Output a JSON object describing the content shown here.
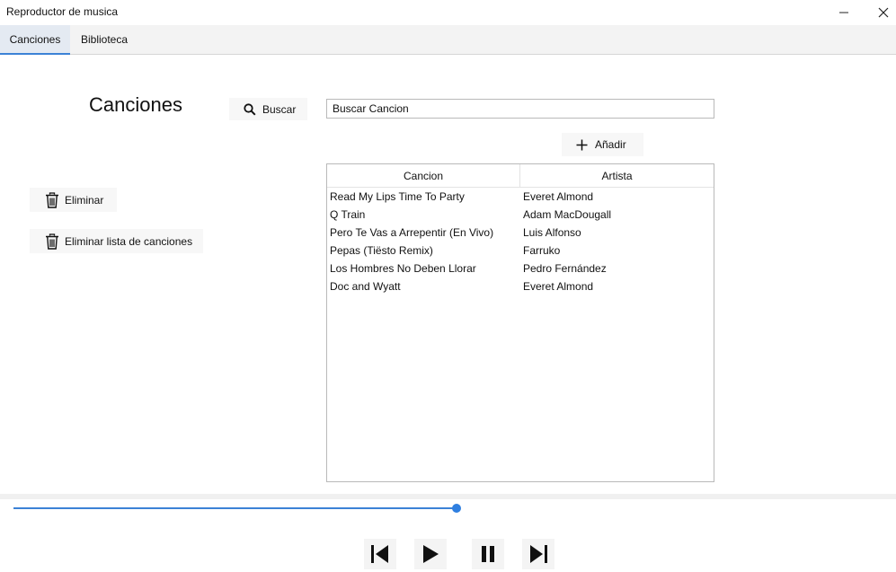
{
  "window": {
    "title": "Reproductor de musica"
  },
  "tabs": [
    {
      "label": "Canciones",
      "active": true
    },
    {
      "label": "Biblioteca",
      "active": false
    }
  ],
  "main": {
    "heading": "Canciones",
    "search_button_label": "Buscar",
    "search_input_value": "Buscar Cancion",
    "add_button_label": "Añadir",
    "delete_button_label": "Eliminar",
    "delete_list_button_label": "Eliminar lista de canciones"
  },
  "table": {
    "columns": [
      "Cancion",
      "Artista"
    ],
    "rows": [
      {
        "cancion": "Read My Lips Time To Party",
        "artista": "Everet Almond"
      },
      {
        "cancion": "Q Train",
        "artista": "Adam MacDougall"
      },
      {
        "cancion": "Pero Te Vas a Arrepentir (En Vivo)",
        "artista": "Luis Alfonso"
      },
      {
        "cancion": "Pepas (Tiësto Remix)",
        "artista": "Farruko"
      },
      {
        "cancion": "Los Hombres No Deben Llorar",
        "artista": "Pedro Fernández"
      },
      {
        "cancion": "Doc and Wyatt",
        "artista": "Everet Almond"
      }
    ]
  },
  "player": {
    "progress_fraction": 0.51,
    "controls": [
      "previous-track-icon",
      "play-icon",
      "pause-icon",
      "next-track-icon"
    ]
  },
  "colors": {
    "accent": "#3b82d6",
    "tab_active_bg": "#e4eaf2"
  },
  "icons": {
    "search": "search-icon",
    "add": "plus-icon",
    "delete": "trash-icon",
    "minimize": "minimize-icon",
    "close": "close-icon"
  }
}
